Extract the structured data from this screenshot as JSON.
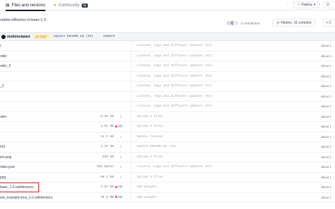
{
  "tabs": {
    "files_label": "Files and versions",
    "community_label": "Community",
    "community_count": "11",
    "deploy_label": "Deploy",
    "right_btn_label": "U"
  },
  "branch": {
    "name": "stable-diffusion-xl-base-1.0",
    "contributors_label": "5 contributors",
    "history_label": "History: 10 commits",
    "plus_label": "+ C"
  },
  "commit": {
    "user": "multimodalart",
    "badge": "HF STAFF",
    "message": "Update README.md (#8)",
    "hash": "ee8a74"
  },
  "files": [
    {
      "name": "r",
      "size": "",
      "lfs": false,
      "message": "License, tags and diffusers updates (#2)",
      "date": "about 1"
    },
    {
      "name": "oder",
      "size": "",
      "lfs": false,
      "message": "License, tags and diffusers updates (#2)",
      "date": "about 1"
    },
    {
      "name": "oder_2",
      "size": "",
      "lfs": false,
      "message": "License, tags and diffusers updates (#2)",
      "date": "about 1"
    },
    {
      "name": "",
      "size": "",
      "lfs": false,
      "message": "License, tags and diffusers updates (#2)",
      "date": "about 1"
    },
    {
      "name": "_2",
      "size": "",
      "lfs": false,
      "message": "License, tags and diffusers updates (#2)",
      "date": "about 1"
    },
    {
      "name": "",
      "size": "",
      "lfs": false,
      "message": "License, tags and diffusers updates (#2)",
      "date": "about 1"
    },
    {
      "name": "",
      "size": "",
      "lfs": false,
      "message": "License, tags and diffusers updates (#2)",
      "date": "about 1"
    },
    {
      "name": "utes",
      "size": "5.96 kB",
      "lfs": false,
      "message": "Upload 3 files",
      "date": "about 1"
    },
    {
      "name": "",
      "size": "4.01 MB",
      "lfs": true,
      "message": "Upload 3 files",
      "date": "about 1"
    },
    {
      "name": "",
      "size": "14.1 kB",
      "lfs": false,
      "message": "Update license",
      "date": "about 1"
    },
    {
      "name": "md",
      "size": "1.1k kB",
      "lfs": false,
      "message": "Update README.md (#8)",
      "date": "about 1"
    },
    {
      "name": "ion.png",
      "size": "590 kB",
      "lfs": false,
      "message": "Upload 3 files",
      "date": "about 1"
    },
    {
      "name": "ndex.json",
      "size": "582 Bytes",
      "lfs": false,
      "message": "License, tags and diffusers updates (#2)",
      "date": "about 1"
    },
    {
      "name": "png",
      "size": "80.2 kB",
      "lfs": false,
      "message": "Upload 3 files",
      "date": "about 1"
    },
    {
      "name": "base_1.0.safetensors",
      "size": "6.94 GB",
      "lfs": true,
      "message": "add weights",
      "date": "about 1"
    },
    {
      "name": "set_example-lora_1.0.safetensors",
      "size": "49.6 MB",
      "lfs": true,
      "message": "add weights",
      "date": "about 1"
    }
  ],
  "lfs_label": "LFS",
  "colors": {
    "highlight": "#dc2626",
    "lfs_dot": "#ef4444",
    "staff_badge_bg": "#fef3c7"
  }
}
